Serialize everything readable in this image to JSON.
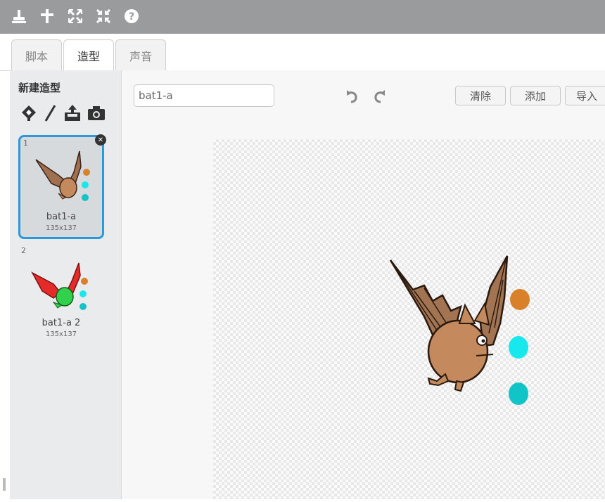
{
  "toolbar": {
    "tools": [
      {
        "icon": "stamp-icon"
      },
      {
        "icon": "delete-cut-icon"
      },
      {
        "icon": "grow-icon"
      },
      {
        "icon": "shrink-icon"
      },
      {
        "icon": "help-icon"
      }
    ]
  },
  "tabs": [
    {
      "label": "脚本",
      "active": false
    },
    {
      "label": "造型",
      "active": true
    },
    {
      "label": "声音",
      "active": false
    }
  ],
  "sidebar": {
    "new_costume_label": "新建造型",
    "new_costume_icons": [
      "choose-from-library-icon",
      "paint-brush-icon",
      "upload-icon",
      "camera-icon"
    ],
    "costumes": [
      {
        "number": "1",
        "name": "bat1-a",
        "size": "135x137",
        "selected": true
      },
      {
        "number": "2",
        "name": "bat1-a 2",
        "size": "135x137",
        "selected": false
      }
    ]
  },
  "editor": {
    "costume_name_value": "bat1-a",
    "clear_label": "清除",
    "add_label": "添加",
    "import_label": "导入"
  },
  "colors": {
    "selection_border": "#2b9ad8",
    "bat_body": "#c48a5e",
    "dot_orange": "#d8802a",
    "dot_cyan": "#16e8ee",
    "dot_teal": "#10c4c8",
    "bat2_wing": "#e52a2a",
    "bat2_body": "#2fd24a"
  }
}
